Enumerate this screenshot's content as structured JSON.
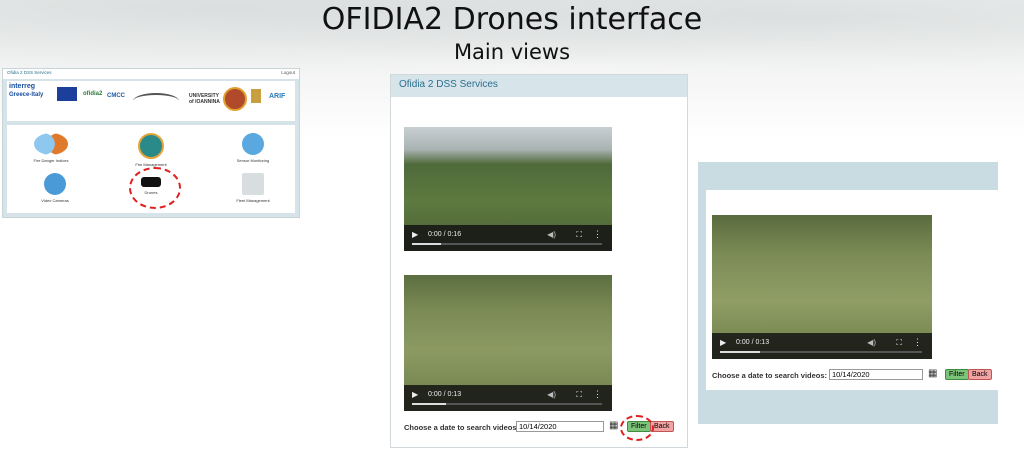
{
  "slide": {
    "title": "OFIDIA2 Drones interface",
    "subtitle": "Main views"
  },
  "home_view": {
    "app_title": "Ofidia 2 DSS Services",
    "logout": "Logout",
    "logos": [
      "interreg Greece-Italy",
      "ofidia2",
      "CMCC",
      "UNIVERSITY of IOANNINA",
      "ARIF"
    ],
    "tiles": [
      {
        "label": "Fire Danger Indices",
        "icon": "fire-danger-icon"
      },
      {
        "label": "Fire Management",
        "icon": "fire-management-icon"
      },
      {
        "label": "Sensor Monitoring",
        "icon": "sensor-icon"
      },
      {
        "label": "Video Cameras",
        "icon": "camera-icon"
      },
      {
        "label": "Drones",
        "icon": "drone-icon"
      },
      {
        "label": "Fleet Management",
        "icon": "fleet-icon"
      }
    ]
  },
  "drones_view": {
    "app_title": "Ofidia 2 DSS Services",
    "videos": [
      {
        "time": "0:00 / 0:16",
        "progress": 0.15
      },
      {
        "time": "0:00 / 0:13",
        "progress": 0.18
      }
    ],
    "date_label": "Choose a date to search videos:",
    "date_value": "10/14/2020",
    "filter_label": "Filter",
    "back_label": "Back"
  },
  "filtered_view": {
    "videos": [
      {
        "time": "0:00 / 0:13",
        "progress": 0.2
      }
    ],
    "date_label": "Choose a date to search videos:",
    "date_value": "10/14/2020",
    "filter_label": "Filter",
    "back_label": "Back"
  },
  "colors": {
    "header_bg": "#d7e4ea",
    "app_title": "#2a6f8f",
    "filter_btn": "#7cc47a",
    "back_btn": "#f1a3a3",
    "highlight_circle": "#e02020"
  }
}
